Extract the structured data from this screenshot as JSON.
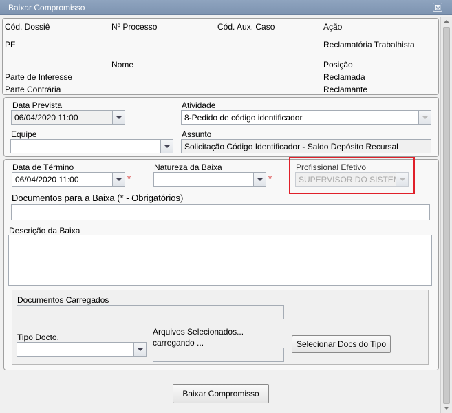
{
  "window": {
    "title": "Baixar Compromisso",
    "close_icon": "⊠"
  },
  "info": {
    "headers": {
      "dossie": "Cód. Dossiê",
      "processo": "Nº Processo",
      "aux_caso": "Cód. Aux. Caso",
      "acao": "Ação"
    },
    "dossie_value": "PF",
    "processo_value": "",
    "acao_value": "Reclamatória Trabalhista",
    "nome_header": "Nome",
    "posicao_header": "Posição",
    "rows": [
      {
        "label": "Parte de Interesse",
        "nome": "",
        "posicao": "Reclamada"
      },
      {
        "label": "Parte Contrária",
        "nome": "",
        "posicao": "Reclamante"
      }
    ]
  },
  "form1": {
    "data_prevista_label": "Data Prevista",
    "data_prevista_value": "06/04/2020 11:00",
    "atividade_label": "Atividade",
    "atividade_value": "8-Pedido de código identificador",
    "equipe_label": "Equipe",
    "equipe_value": "",
    "assunto_label": "Assunto",
    "assunto_value": "Solicitação Código Identificador - Saldo Depósito Recursal"
  },
  "form2": {
    "data_termino_label": "Data de Término",
    "data_termino_value": "06/04/2020 11:00",
    "required_mark": "*",
    "natureza_label": "Natureza da Baixa",
    "natureza_value": "",
    "profissional_label": "Profissional Efetivo",
    "profissional_value": "SUPERVISOR DO SISTEMA",
    "documentos_label": "Documentos para a Baixa (* - Obrigatórios)",
    "descricao_label": "Descrição da Baixa",
    "docs_carregados_label": "Documentos Carregados",
    "tipo_docto_label": "Tipo Docto.",
    "arquivos_label": "Arquivos Selecionados...",
    "carregando_label": "carregando ...",
    "selecionar_button": "Selecionar Docs do Tipo"
  },
  "footer": {
    "baixar_button": "Baixar Compromisso"
  },
  "colors": {
    "highlight": "#e0202a",
    "required": "#d00000",
    "titlebar": "#8fa4bf"
  }
}
